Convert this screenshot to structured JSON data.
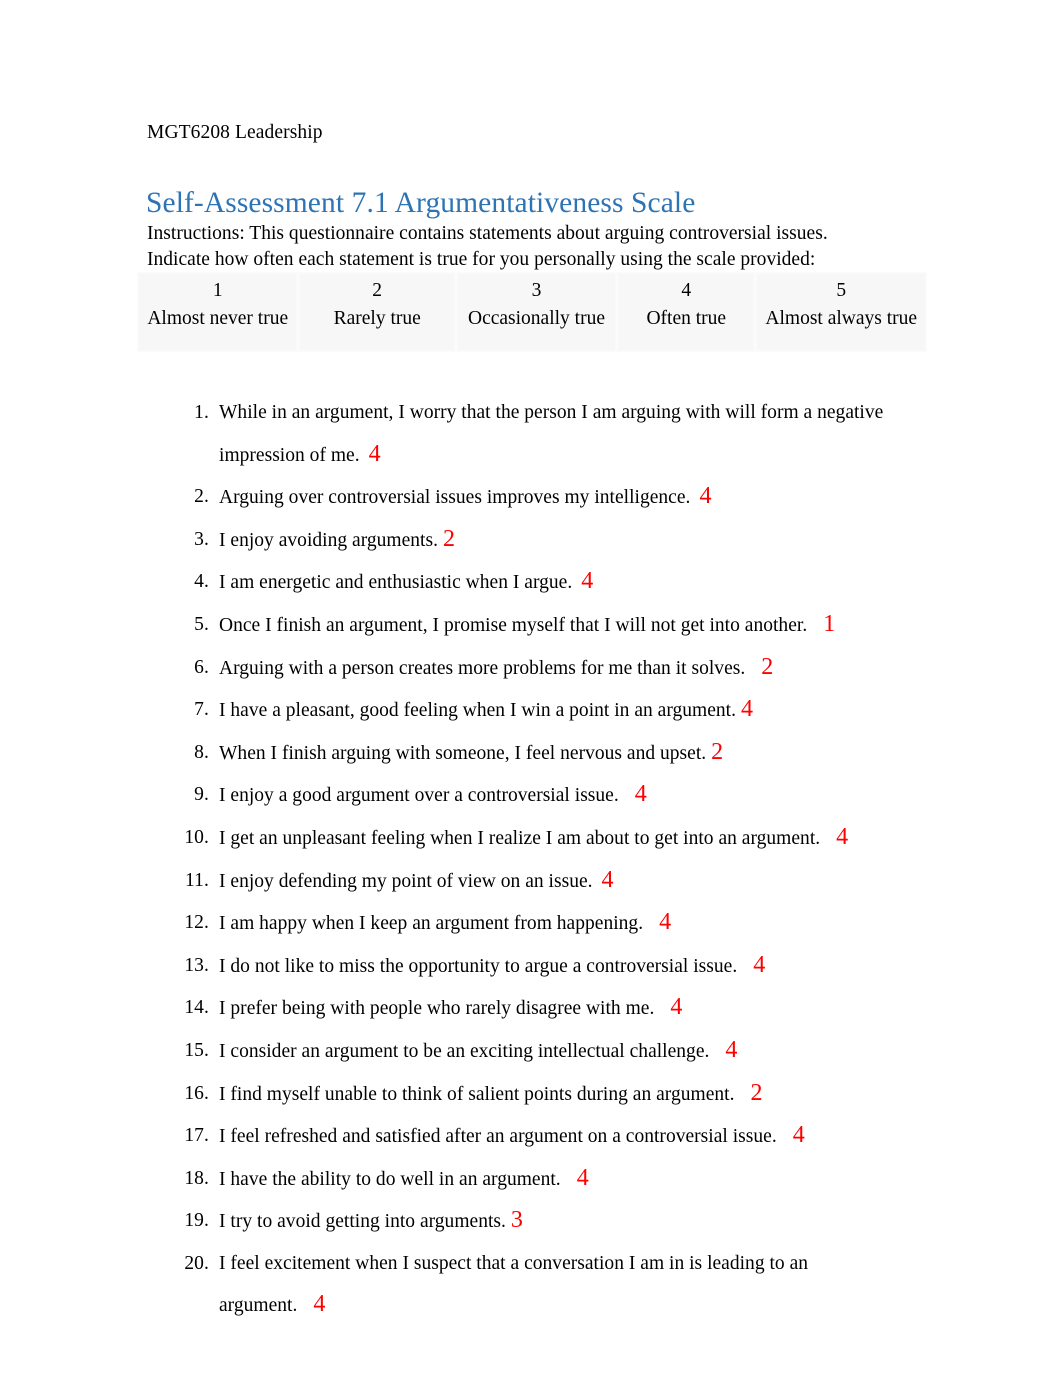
{
  "document": {
    "course_line": "MGT6208 Leadership",
    "heading": "Self-Assessment 7.1 Argumentativeness Scale",
    "instructions": "Instructions: This questionnaire contains statements about arguing controversial issues. Indicate how often each statement is true for you personally using the scale provided:"
  },
  "scale": {
    "columns": [
      {
        "number": "1",
        "label": "Almost never true"
      },
      {
        "number": "2",
        "label": "Rarely true"
      },
      {
        "number": "3",
        "label": "Occasionally true"
      },
      {
        "number": "4",
        "label": "Often true"
      },
      {
        "number": "5",
        "label": "Almost always true"
      }
    ]
  },
  "colors": {
    "heading_blue": "#2E74B5",
    "answer_red": "#FF0000",
    "table_cell_fill": "#F7F7F7"
  },
  "questions": [
    {
      "number": "1.",
      "text": "While in an argument, I worry that the person I am arguing with will form a negative impression of me.",
      "answer": "4"
    },
    {
      "number": "2.",
      "text": "Arguing over controversial issues improves my intelligence.",
      "answer": "4"
    },
    {
      "number": "3.",
      "text": "I enjoy avoiding arguments.",
      "answer": "2"
    },
    {
      "number": "4.",
      "text": "I am energetic and enthusiastic when I argue.",
      "answer": "4"
    },
    {
      "number": "5.",
      "text": "Once I finish an argument, I promise myself that I will not get into another.",
      "answer": "1"
    },
    {
      "number": "6.",
      "text": "Arguing with a person creates more problems for me than it solves.",
      "answer": "2"
    },
    {
      "number": "7.",
      "text": "I have a pleasant, good feeling when I win a point in an argument.",
      "answer": "4"
    },
    {
      "number": "8.",
      "text": "When I finish arguing with someone, I feel nervous and upset.",
      "answer": "2"
    },
    {
      "number": "9.",
      "text": "I enjoy a good argument over a controversial issue.",
      "answer": "4"
    },
    {
      "number": "10.",
      "text": "I get an unpleasant feeling when I realize I am about to get into an argument.",
      "answer": "4"
    },
    {
      "number": "11.",
      "text": "I enjoy defending my point of view on an issue.",
      "answer": "4"
    },
    {
      "number": "12.",
      "text": "I am happy when I keep an argument from happening.",
      "answer": "4"
    },
    {
      "number": "13.",
      "text": "I do not like to miss the opportunity to argue a controversial issue.",
      "answer": "4"
    },
    {
      "number": "14.",
      "text": "I prefer being with people who rarely disagree with me.",
      "answer": "4"
    },
    {
      "number": "15.",
      "text": "I consider an argument to be an exciting intellectual challenge.",
      "answer": "4"
    },
    {
      "number": "16.",
      "text": "I find myself unable to think of salient points during an argument.",
      "answer": "2"
    },
    {
      "number": "17.",
      "text": "I feel refreshed and satisfied after an argument on a controversial issue.",
      "answer": "4"
    },
    {
      "number": "18.",
      "text": "I have the ability to do well in an argument.",
      "answer": "4"
    },
    {
      "number": "19.",
      "text": "I try to avoid getting into arguments.",
      "answer": "3"
    },
    {
      "number": "20.",
      "text": "I feel excitement when I suspect that a conversation I am in is leading to an argument.",
      "answer": "4"
    }
  ]
}
